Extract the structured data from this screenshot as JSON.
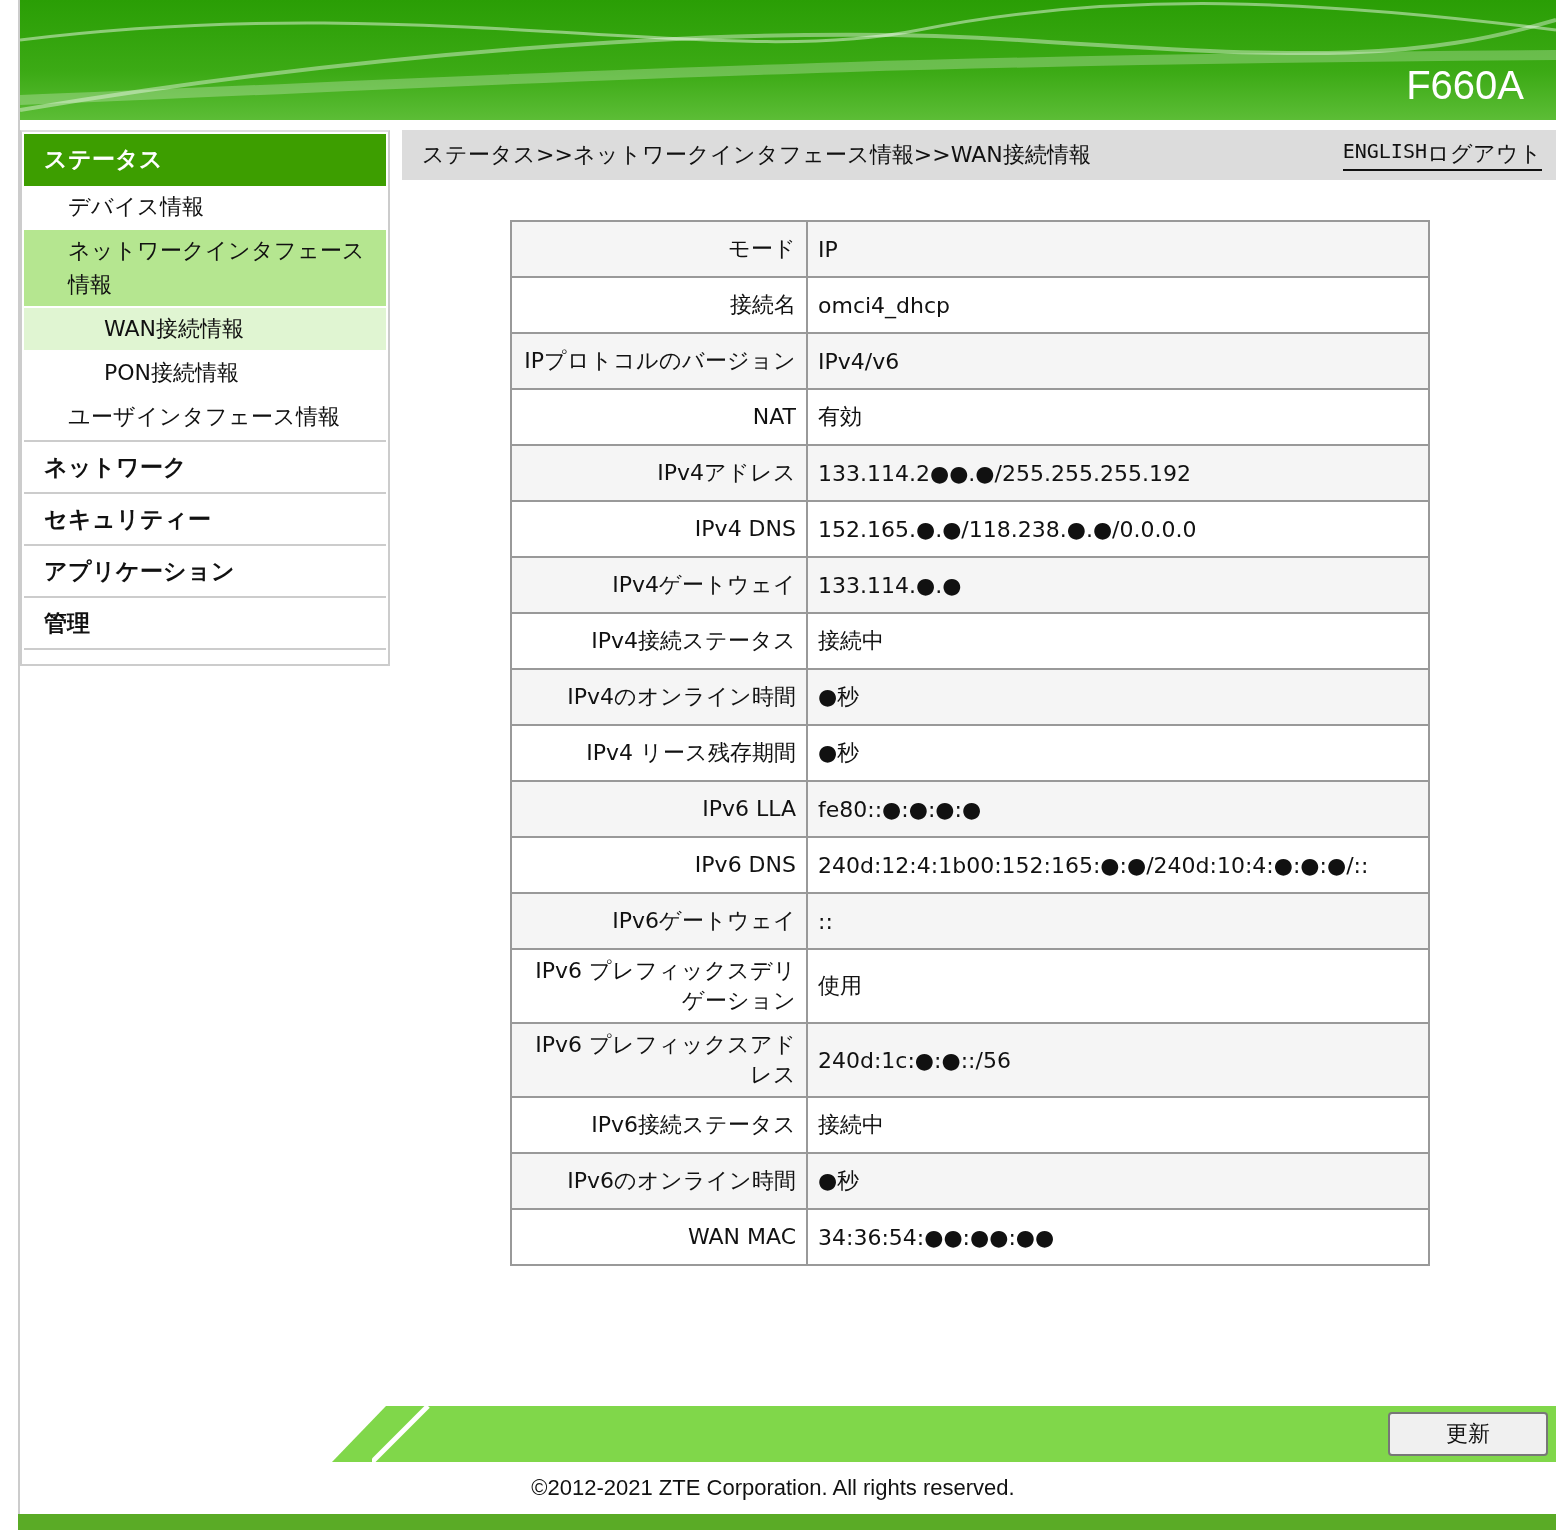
{
  "header": {
    "model": "F660A"
  },
  "sidebar": {
    "items": [
      {
        "label": "ステータス",
        "selected": true,
        "children": [
          {
            "label": "デバイス情報",
            "selected": false
          },
          {
            "label": "ネットワークインタフェース情報",
            "selected": true,
            "children": [
              {
                "label": "WAN接続情報",
                "selected": true
              },
              {
                "label": "PON接続情報",
                "selected": false
              }
            ]
          },
          {
            "label": "ユーザインタフェース情報",
            "selected": false
          }
        ]
      },
      {
        "label": "ネットワーク",
        "selected": false
      },
      {
        "label": "セキュリティー",
        "selected": false
      },
      {
        "label": "アプリケーション",
        "selected": false
      },
      {
        "label": "管理",
        "selected": false
      }
    ]
  },
  "breadcrumb": "ステータス>>ネットワークインタフェース情報>>WAN接続情報",
  "top_links": [
    "ENGLISH",
    "ログアウト"
  ],
  "table": {
    "rows": [
      {
        "label": "モード",
        "value": "IP"
      },
      {
        "label": "接続名",
        "value": "omci4_dhcp"
      },
      {
        "label": "IPプロトコルのバージョン",
        "value": "IPv4/v6"
      },
      {
        "label": "NAT",
        "value": "有効"
      },
      {
        "label": "IPv4アドレス",
        "value": "133.114.2●●.●/255.255.255.192"
      },
      {
        "label": "IPv4 DNS",
        "value": "152.165.●.●/118.238.●.●/0.0.0.0"
      },
      {
        "label": "IPv4ゲートウェイ",
        "value": "133.114.●.●"
      },
      {
        "label": "IPv4接続ステータス",
        "value": "接続中"
      },
      {
        "label": "IPv4のオンライン時間",
        "value": "●秒"
      },
      {
        "label": "IPv4 リース残存期間",
        "value": "●秒"
      },
      {
        "label": "IPv6 LLA",
        "value": "fe80::●:●:●:●"
      },
      {
        "label": "IPv6 DNS",
        "value": "240d:12:4:1b00:152:165:●:●/240d:10:4:●:●:●/::"
      },
      {
        "label": "IPv6ゲートウェイ",
        "value": "::"
      },
      {
        "label": "IPv6 プレフィックスデリゲーション",
        "value": "使用"
      },
      {
        "label": "IPv6 プレフィックスアドレス",
        "value": "240d:1c:●:●::/56"
      },
      {
        "label": "IPv6接続ステータス",
        "value": "接続中"
      },
      {
        "label": "IPv6のオンライン時間",
        "value": "●秒"
      },
      {
        "label": "WAN MAC",
        "value": "34:36:54:●●:●●:●●"
      }
    ]
  },
  "refresh_button": "更新",
  "footer": "©2012-2021 ZTE Corporation. All rights reserved."
}
